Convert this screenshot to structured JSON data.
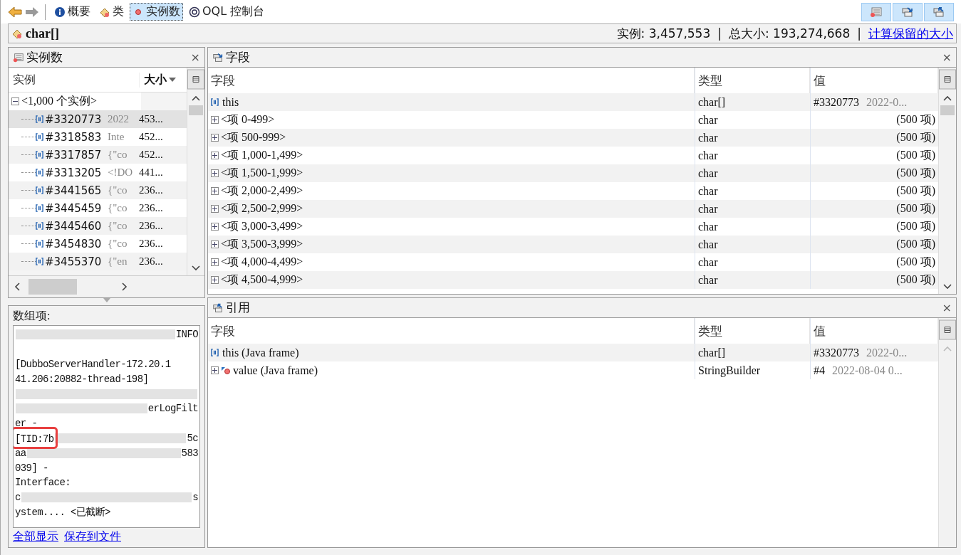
{
  "toolbar": {
    "tabs": [
      {
        "label": "概要",
        "selected": false
      },
      {
        "label": "类",
        "selected": false
      },
      {
        "label": "实例数",
        "selected": true
      },
      {
        "label": "OQL 控制台",
        "selected": false
      }
    ],
    "views": [
      {
        "on": true
      },
      {
        "on": true
      },
      {
        "on": true
      }
    ]
  },
  "class_bar": {
    "name": "char[]",
    "instances": "实例: 3,457,553",
    "separator_1": "|",
    "total_size": "总大小: 193,274,668",
    "separator_2": "|",
    "retained_link": "计算保留的大小"
  },
  "instances_panel": {
    "title": "实例数",
    "close": "×",
    "columns": [
      "实例",
      "大小"
    ],
    "root": {
      "label": "<1,000 个实例>",
      "expanded": true,
      "children": [
        {
          "id": "#3320773",
          "preview": "2022",
          "size": "453...",
          "selected": true
        },
        {
          "id": "#3318583",
          "preview": "Inte",
          "size": "452...",
          "selected": false
        },
        {
          "id": "#3317857",
          "preview": "{\"co",
          "size": "452...",
          "selected": false
        },
        {
          "id": "#3313205",
          "preview": "<!DO",
          "size": "441...",
          "selected": false
        },
        {
          "id": "#3441565",
          "preview": "{\"co",
          "size": "236...",
          "selected": false
        },
        {
          "id": "#3445459",
          "preview": "{\"co",
          "size": "236...",
          "selected": false
        },
        {
          "id": "#3445460",
          "preview": "{\"co",
          "size": "236...",
          "selected": false
        },
        {
          "id": "#3454830",
          "preview": "{\"co",
          "size": "236...",
          "selected": false
        },
        {
          "id": "#3455370",
          "preview": "{\"en",
          "size": "236...",
          "selected": false
        }
      ]
    }
  },
  "array_items": {
    "label": "数组项:",
    "lines": [
      {
        "blank_after": true,
        "segments": [
          {
            "kind": "blur"
          },
          {
            "kind": "text",
            "text": "INFO"
          }
        ]
      },
      {
        "segments": [
          {
            "kind": "text",
            "text": "[DubboServerHandler-172.20.1"
          }
        ]
      },
      {
        "segments": [
          {
            "kind": "text",
            "text": "41.206:20882-thread-198]"
          }
        ]
      },
      {
        "segments": [
          {
            "kind": "blur"
          }
        ]
      },
      {
        "segments": [
          {
            "kind": "blur"
          },
          {
            "kind": "text",
            "text": "erLogFilt"
          }
        ]
      },
      {
        "segments": [
          {
            "kind": "text",
            "text": "er -"
          }
        ]
      },
      {
        "segments": [
          {
            "kind": "text",
            "text": "[TID:7b",
            "highlight": true
          },
          {
            "kind": "blur"
          },
          {
            "kind": "text",
            "text": "5c"
          }
        ]
      },
      {
        "segments": [
          {
            "kind": "text",
            "text": "aa"
          },
          {
            "kind": "blur"
          },
          {
            "kind": "text",
            "text": "583"
          }
        ]
      },
      {
        "segments": [
          {
            "kind": "text",
            "text": "039] -"
          }
        ]
      },
      {
        "segments": [
          {
            "kind": "text",
            "text": "Interface:"
          }
        ]
      },
      {
        "segments": [
          {
            "kind": "text",
            "text": "c"
          },
          {
            "kind": "blur"
          },
          {
            "kind": "text",
            "text": "s"
          }
        ]
      },
      {
        "segments": [
          {
            "kind": "text",
            "text": "ystem....  <已截断>"
          }
        ]
      }
    ],
    "links": [
      "全部显示",
      "保存到文件"
    ]
  },
  "fields_panel": {
    "title": "字段",
    "close": "×",
    "columns": [
      "字段",
      "类型",
      "值"
    ],
    "rows": [
      {
        "kind": "this",
        "name": "this",
        "type": "char[]",
        "value": "#3320773",
        "preview": "2022-0..."
      },
      {
        "kind": "group",
        "name": "<项 0-499>",
        "type": "char",
        "count": "(500 项)"
      },
      {
        "kind": "group",
        "name": "<项 500-999>",
        "type": "char",
        "count": "(500 项)"
      },
      {
        "kind": "group",
        "name": "<项 1,000-1,499>",
        "type": "char",
        "count": "(500 项)"
      },
      {
        "kind": "group",
        "name": "<项 1,500-1,999>",
        "type": "char",
        "count": "(500 项)"
      },
      {
        "kind": "group",
        "name": "<项 2,000-2,499>",
        "type": "char",
        "count": "(500 项)"
      },
      {
        "kind": "group",
        "name": "<项 2,500-2,999>",
        "type": "char",
        "count": "(500 项)"
      },
      {
        "kind": "group",
        "name": "<项 3,000-3,499>",
        "type": "char",
        "count": "(500 项)"
      },
      {
        "kind": "group",
        "name": "<项 3,500-3,999>",
        "type": "char",
        "count": "(500 项)"
      },
      {
        "kind": "group",
        "name": "<项 4,000-4,499>",
        "type": "char",
        "count": "(500 项)"
      },
      {
        "kind": "group",
        "name": "<项 4,500-4,999>",
        "type": "char",
        "count": "(500 项)"
      }
    ]
  },
  "references_panel": {
    "title": "引用",
    "close": "×",
    "columns": [
      "字段",
      "类型",
      "值"
    ],
    "rows": [
      {
        "kind": "this",
        "name": "this (Java frame)",
        "type": "char[]",
        "value": "#3320773",
        "preview": "2022-0..."
      },
      {
        "kind": "ref",
        "name": "value (Java frame)",
        "type": "StringBuilder",
        "value": "#4",
        "preview": "2022-08-04 0..."
      }
    ]
  }
}
